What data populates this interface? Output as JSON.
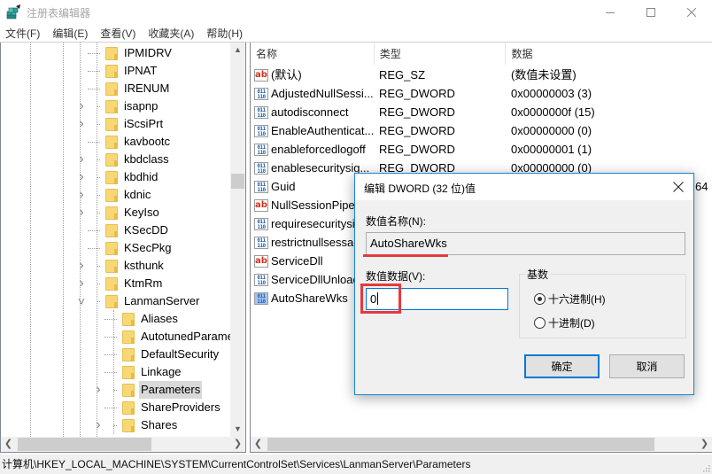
{
  "window": {
    "title": "注册表编辑器",
    "icons": {
      "app": "registry-editor-icon",
      "minimize": "minimize-icon",
      "maximize": "maximize-icon",
      "close": "close-icon"
    }
  },
  "menu": [
    {
      "label": "文件(F)"
    },
    {
      "label": "编辑(E)"
    },
    {
      "label": "查看(V)"
    },
    {
      "label": "收藏夹(A)"
    },
    {
      "label": "帮助(H)"
    }
  ],
  "tree": {
    "items": [
      {
        "label": "IPMIDRV",
        "level": 0,
        "expander": "none"
      },
      {
        "label": "IPNAT",
        "level": 0,
        "expander": "none"
      },
      {
        "label": "IRENUM",
        "level": 0,
        "expander": "none"
      },
      {
        "label": "isapnp",
        "level": 0,
        "expander": "collapsed"
      },
      {
        "label": "iScsiPrt",
        "level": 0,
        "expander": "collapsed"
      },
      {
        "label": "kavbootc",
        "level": 0,
        "expander": "none"
      },
      {
        "label": "kbdclass",
        "level": 0,
        "expander": "collapsed"
      },
      {
        "label": "kbdhid",
        "level": 0,
        "expander": "collapsed"
      },
      {
        "label": "kdnic",
        "level": 0,
        "expander": "collapsed"
      },
      {
        "label": "KeyIso",
        "level": 0,
        "expander": "collapsed"
      },
      {
        "label": "KSecDD",
        "level": 0,
        "expander": "none"
      },
      {
        "label": "KSecPkg",
        "level": 0,
        "expander": "none"
      },
      {
        "label": "ksthunk",
        "level": 0,
        "expander": "collapsed"
      },
      {
        "label": "KtmRm",
        "level": 0,
        "expander": "collapsed"
      },
      {
        "label": "LanmanServer",
        "level": 0,
        "expander": "expanded"
      },
      {
        "label": "Aliases",
        "level": 1,
        "expander": "none"
      },
      {
        "label": "AutotunedParameters",
        "level": 1,
        "expander": "none"
      },
      {
        "label": "DefaultSecurity",
        "level": 1,
        "expander": "none"
      },
      {
        "label": "Linkage",
        "level": 1,
        "expander": "none"
      },
      {
        "label": "Parameters",
        "level": 1,
        "expander": "collapsed",
        "selected": true
      },
      {
        "label": "ShareProviders",
        "level": 1,
        "expander": "none"
      },
      {
        "label": "Shares",
        "level": 1,
        "expander": "collapsed"
      }
    ]
  },
  "list": {
    "columns": [
      {
        "label": "名称"
      },
      {
        "label": "类型"
      },
      {
        "label": "数据"
      }
    ],
    "rows": [
      {
        "name": "(默认)",
        "type": "REG_SZ",
        "data": "(数值未设置)",
        "icon": "string-value-icon"
      },
      {
        "name": "AdjustedNullSessi...",
        "type": "REG_DWORD",
        "data": "0x00000003 (3)",
        "icon": "binary-value-icon"
      },
      {
        "name": "autodisconnect",
        "type": "REG_DWORD",
        "data": "0x0000000f (15)",
        "icon": "binary-value-icon"
      },
      {
        "name": "EnableAuthenticat...",
        "type": "REG_DWORD",
        "data": "0x00000000 (0)",
        "icon": "binary-value-icon"
      },
      {
        "name": "enableforcedlogoff",
        "type": "REG_DWORD",
        "data": "0x00000001 (1)",
        "icon": "binary-value-icon"
      },
      {
        "name": "enablesecuritysig...",
        "type": "REG_DWORD",
        "data": "0x00000000 (0)",
        "icon": "binary-value-icon"
      },
      {
        "name": "Guid",
        "type": "",
        "data": "64",
        "icon": "binary-value-icon"
      },
      {
        "name": "NullSessionPipes",
        "type": "",
        "data": "",
        "icon": "string-value-icon"
      },
      {
        "name": "requiresecuritysi",
        "type": "",
        "data": "",
        "icon": "binary-value-icon"
      },
      {
        "name": "restrictnullsessac",
        "type": "",
        "data": "",
        "icon": "binary-value-icon"
      },
      {
        "name": "ServiceDll",
        "type": "",
        "data": "",
        "icon": "string-value-icon"
      },
      {
        "name": "ServiceDllUnload",
        "type": "",
        "data": "",
        "icon": "binary-value-icon"
      },
      {
        "name": "AutoShareWks",
        "type": "",
        "data": "",
        "icon": "binary-value-icon",
        "selected": true
      }
    ]
  },
  "status": {
    "path": "计算机\\HKEY_LOCAL_MACHINE\\SYSTEM\\CurrentControlSet\\Services\\LanmanServer\\Parameters"
  },
  "dialog": {
    "title": "编辑 DWORD (32 位)值",
    "name_label": "数值名称(N):",
    "name_value": "AutoShareWks",
    "data_label": "数值数据(V):",
    "data_value": "0",
    "radix_label": "基数",
    "radix_options": [
      {
        "label": "十六进制(H)",
        "checked": true
      },
      {
        "label": "十进制(D)",
        "checked": false
      }
    ],
    "ok_label": "确定",
    "cancel_label": "取消",
    "annotation_color": "#e8383d",
    "accent_color": "#0078d7"
  }
}
